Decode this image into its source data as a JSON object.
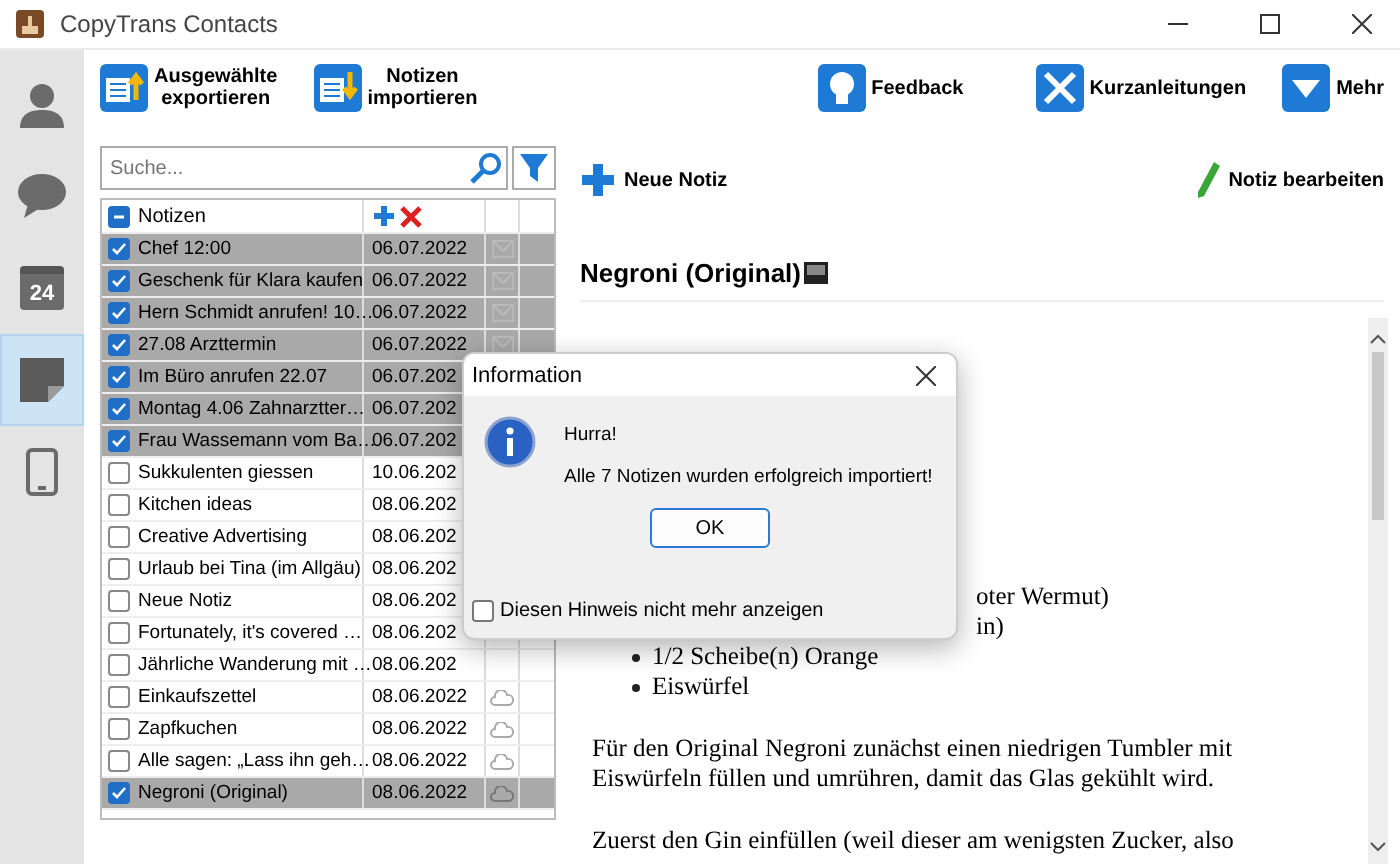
{
  "window": {
    "title": "CopyTrans Contacts"
  },
  "nav": [
    {
      "kind": "contacts",
      "selected": false
    },
    {
      "kind": "messages",
      "selected": false
    },
    {
      "kind": "calendar",
      "day": "24",
      "selected": false
    },
    {
      "kind": "notes",
      "selected": true
    },
    {
      "kind": "device",
      "selected": false
    }
  ],
  "toolbar": [
    {
      "kind": "export",
      "label": "Ausgewählte\nexportieren"
    },
    {
      "kind": "import",
      "label": "Notizen\nimportieren"
    },
    {
      "kind": "feedback",
      "label": "Feedback"
    },
    {
      "kind": "guides",
      "label": "Kurzanleitungen"
    },
    {
      "kind": "more",
      "label": "Mehr"
    }
  ],
  "search": {
    "placeholder": "Suche..."
  },
  "list": {
    "header": "Notizen",
    "rows": [
      {
        "name": "Chef 12:00",
        "date": "06.07.2022",
        "checked": true,
        "kind": "mail"
      },
      {
        "name": "Geschenk für Klara kaufen",
        "date": "06.07.2022",
        "checked": true,
        "kind": "mail"
      },
      {
        "name": "Hern Schmidt anrufen! 10…",
        "date": "06.07.2022",
        "checked": true,
        "kind": "mail"
      },
      {
        "name": "27.08 Arzttermin",
        "date": "06.07.2022",
        "checked": true,
        "kind": "mail"
      },
      {
        "name": "Im Büro anrufen 22.07",
        "date": "06.07.202",
        "checked": true
      },
      {
        "name": "Montag 4.06 Zahnarztter…",
        "date": "06.07.202",
        "checked": true
      },
      {
        "name": "Frau Wassemann vom Ba…",
        "date": "06.07.202",
        "checked": true
      },
      {
        "name": "Sukkulenten giessen",
        "date": "10.06.202",
        "checked": false
      },
      {
        "name": "Kitchen ideas",
        "date": "08.06.202",
        "checked": false
      },
      {
        "name": "Creative Advertising",
        "date": "08.06.202",
        "checked": false
      },
      {
        "name": "Urlaub bei Tina (im Allgäu)",
        "date": "08.06.202",
        "checked": false
      },
      {
        "name": "Neue Notiz",
        "date": "08.06.202",
        "checked": false
      },
      {
        "name": "Fortunately, it's covered …",
        "date": "08.06.202",
        "checked": false
      },
      {
        "name": "Jährliche Wanderung mit …",
        "date": "08.06.202",
        "checked": false
      },
      {
        "name": "Einkaufszettel",
        "date": "08.06.2022",
        "checked": false,
        "kind": "cloud"
      },
      {
        "name": "Zapfkuchen",
        "date": "08.06.2022",
        "checked": false,
        "kind": "cloud"
      },
      {
        "name": "Alle sagen: „Lass ihn geh…",
        "date": "08.06.2022",
        "checked": false,
        "kind": "cloud"
      },
      {
        "name": "Negroni (Original)",
        "date": "08.06.2022",
        "checked": true,
        "kind": "cloud"
      }
    ]
  },
  "note_actions": [
    {
      "kind": "new",
      "label": "Neue Notiz"
    },
    {
      "kind": "edit",
      "label": "Notiz bearbeiten"
    }
  ],
  "note": {
    "title": "Negroni (Original)",
    "lines": [
      {
        "kind": "fragment",
        "text": "oter Wermut)"
      },
      {
        "kind": "fragment",
        "text": "in)"
      },
      {
        "kind": "bullet",
        "text": "1/2 Scheibe(n) Orange"
      },
      {
        "kind": "bullet",
        "text": "Eiswürfel"
      },
      {
        "kind": "paragraph",
        "text": "Für den Original Negroni zunächst einen niedrigen Tumbler mit Eiswürfeln füllen und umrühren, damit das Glas gekühlt wird."
      },
      {
        "kind": "paragraph",
        "text": "Zuerst den Gin einfüllen (weil dieser am wenigsten Zucker, also"
      }
    ]
  },
  "dialog": {
    "title": "Information",
    "heading": "Hurra!",
    "message": "Alle 7 Notizen wurden erfolgreich importiert!",
    "button": "OK",
    "checkbox": {
      "label": "Diesen Hinweis nicht mehr anzeigen",
      "checked": false
    }
  }
}
